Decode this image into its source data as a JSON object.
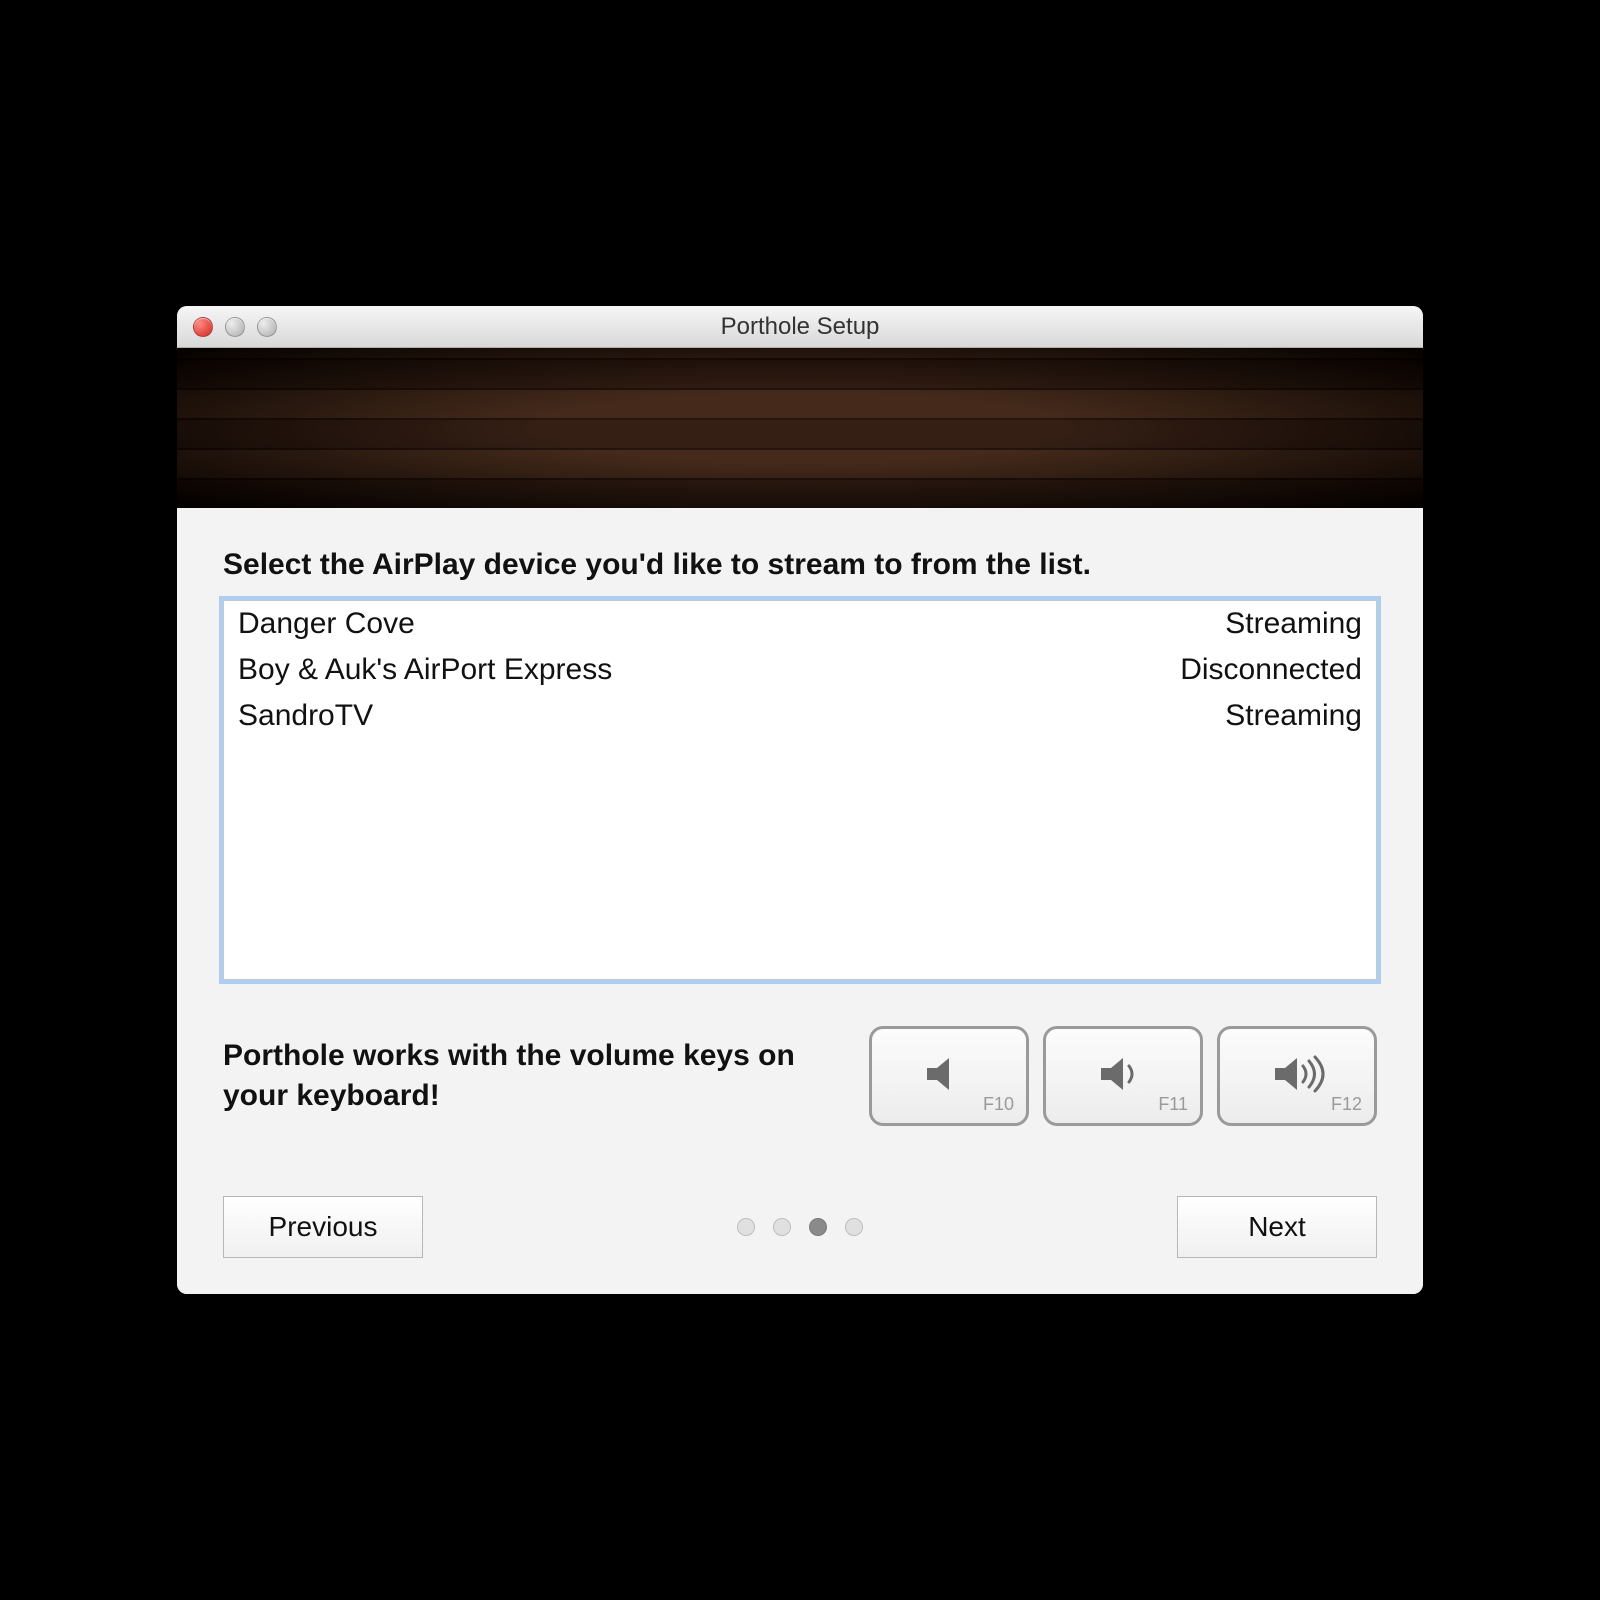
{
  "window": {
    "title": "Porthole Setup"
  },
  "content": {
    "prompt": "Select the AirPlay device you'd like to stream to from the list.",
    "hint": "Porthole works with the volume keys on your keyboard!"
  },
  "devices": [
    {
      "name": "Danger Cove",
      "status": "Streaming"
    },
    {
      "name": "Boy & Auk's AirPort Express",
      "status": "Disconnected"
    },
    {
      "name": "SandroTV",
      "status": "Streaming"
    }
  ],
  "fkeys": [
    {
      "label": "F10",
      "icon": "volume-mute"
    },
    {
      "label": "F11",
      "icon": "volume-down"
    },
    {
      "label": "F12",
      "icon": "volume-up"
    }
  ],
  "pager": {
    "count": 4,
    "active_index": 2
  },
  "buttons": {
    "previous": "Previous",
    "next": "Next"
  }
}
